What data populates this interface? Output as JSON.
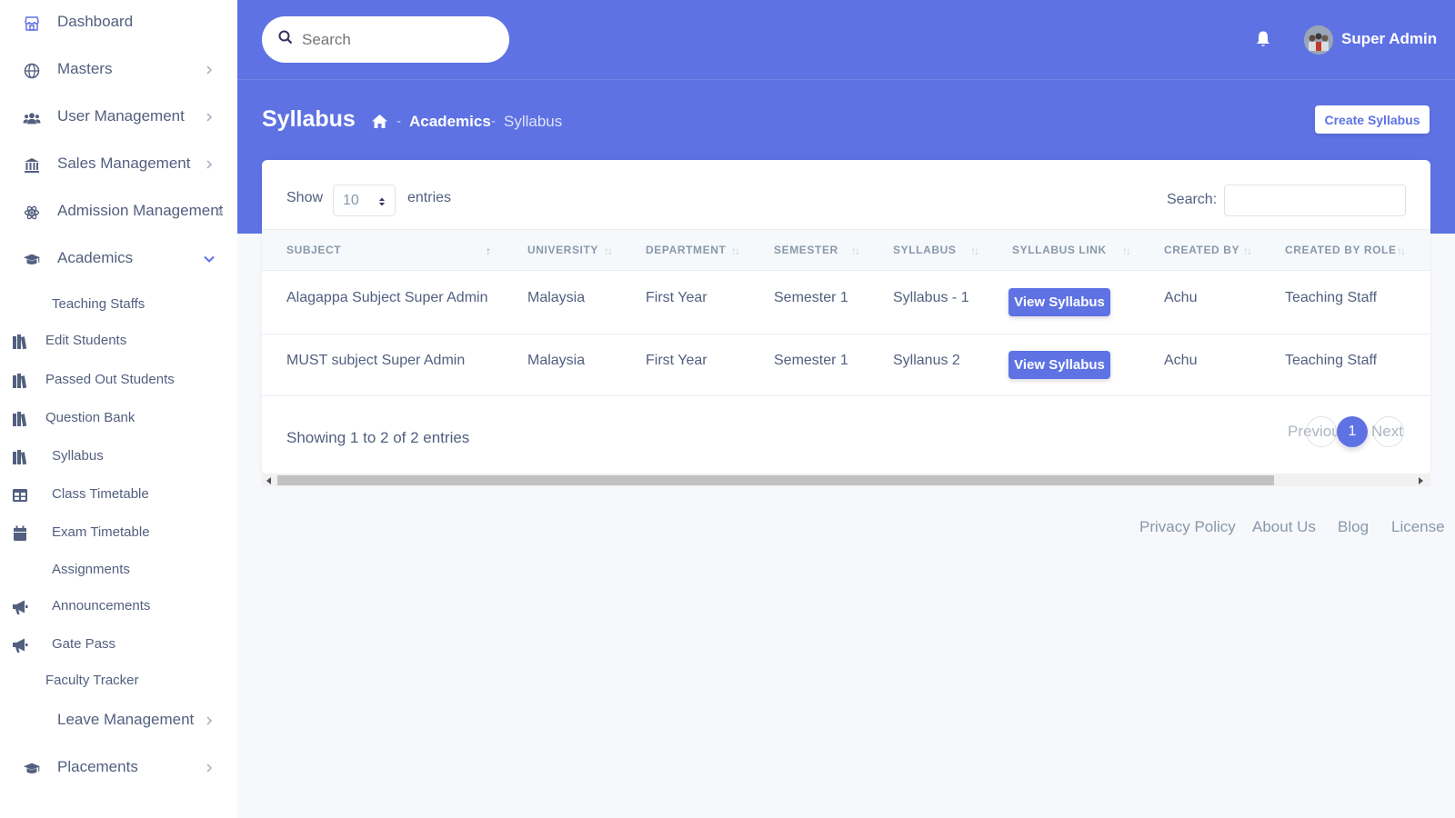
{
  "sidebar": {
    "items": [
      {
        "label": "Dashboard"
      },
      {
        "label": "Masters"
      },
      {
        "label": "User Management"
      },
      {
        "label": "Sales Management"
      },
      {
        "label": "Admission Management"
      },
      {
        "label": "Academics"
      },
      {
        "label": "Teaching Staffs"
      },
      {
        "label": "Edit Students"
      },
      {
        "label": "Passed Out Students"
      },
      {
        "label": "Question Bank"
      },
      {
        "label": "Syllabus"
      },
      {
        "label": "Class Timetable"
      },
      {
        "label": "Exam Timetable"
      },
      {
        "label": "Assignments"
      },
      {
        "label": "Announcements"
      },
      {
        "label": "Gate Pass"
      },
      {
        "label": "Faculty Tracker"
      },
      {
        "label": "Leave Management"
      },
      {
        "label": "Placements"
      }
    ]
  },
  "header": {
    "search_placeholder": "Search",
    "user_name": "Super Admin"
  },
  "page": {
    "title": "Syllabus",
    "breadcrumb": [
      "Academics",
      "Syllabus"
    ],
    "separator": "-",
    "create_label": "Create Syllabus"
  },
  "table": {
    "show_label": "Show",
    "entries_value": "10",
    "entries_label": "entries",
    "search_label": "Search:",
    "columns": [
      "SUBJECT",
      "UNIVERSITY",
      "DEPARTMENT",
      "SEMESTER",
      "SYLLABUS",
      "SYLLABUS LINK",
      "CREATED BY",
      "CREATED BY ROLE"
    ],
    "rows": [
      {
        "subject": "Alagappa Subject Super Admin",
        "university": "Malaysia",
        "department": "First Year",
        "semester": "Semester 1",
        "syllabus": "Syllabus - 1",
        "link_label": "View Syllabus",
        "created_by": "Achu",
        "role": "Teaching Staff"
      },
      {
        "subject": "MUST subject Super Admin",
        "university": "Malaysia",
        "department": "First Year",
        "semester": "Semester 1",
        "syllabus": "Syllanus 2",
        "link_label": "View Syllabus",
        "created_by": "Achu",
        "role": "Teaching Staff"
      }
    ],
    "info": "Showing 1 to 2 of 2 entries",
    "pagination": {
      "prev": "Previous",
      "current": "1",
      "next": "Next"
    }
  },
  "footer": {
    "links": [
      "Privacy Policy",
      "About Us",
      "Blog",
      "License"
    ]
  },
  "colors": {
    "primary": "#5e72e4",
    "text": "#525f7f",
    "muted": "#8898aa"
  }
}
